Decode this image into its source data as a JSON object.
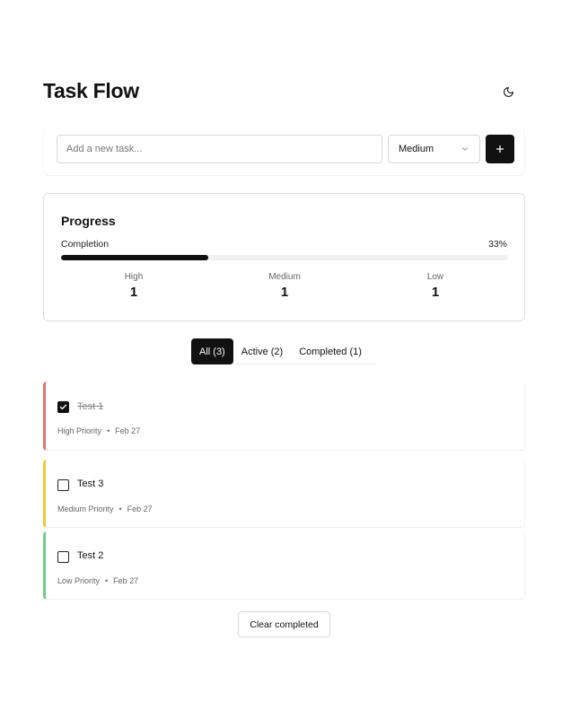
{
  "header": {
    "title": "Task Flow",
    "theme_icon": "moon-icon"
  },
  "add_task": {
    "input_placeholder": "Add a new task...",
    "input_value": "",
    "priority_selected": "Medium",
    "add_icon": "plus-icon"
  },
  "progress": {
    "title": "Progress",
    "completion_label": "Completion",
    "completion_pct_text": "33%",
    "completion_fraction": 0.33,
    "stats": [
      {
        "label": "High",
        "value": "1"
      },
      {
        "label": "Medium",
        "value": "1"
      },
      {
        "label": "Low",
        "value": "1"
      }
    ]
  },
  "filters": [
    {
      "label": "All (3)",
      "active": true
    },
    {
      "label": "Active (2)",
      "active": false
    },
    {
      "label": "Completed (1)",
      "active": false
    }
  ],
  "tasks": [
    {
      "name": "Test 1",
      "completed": true,
      "priority": "High Priority",
      "date": "Feb 27",
      "color": "#e57373"
    },
    {
      "name": "Test 3",
      "completed": false,
      "priority": "Medium Priority",
      "date": "Feb 27",
      "color": "#f0c93a"
    },
    {
      "name": "Test 2",
      "completed": false,
      "priority": "Low Priority",
      "date": "Feb 27",
      "color": "#6ccf86"
    }
  ],
  "clear_label": "Clear completed",
  "meta_separator": "•"
}
